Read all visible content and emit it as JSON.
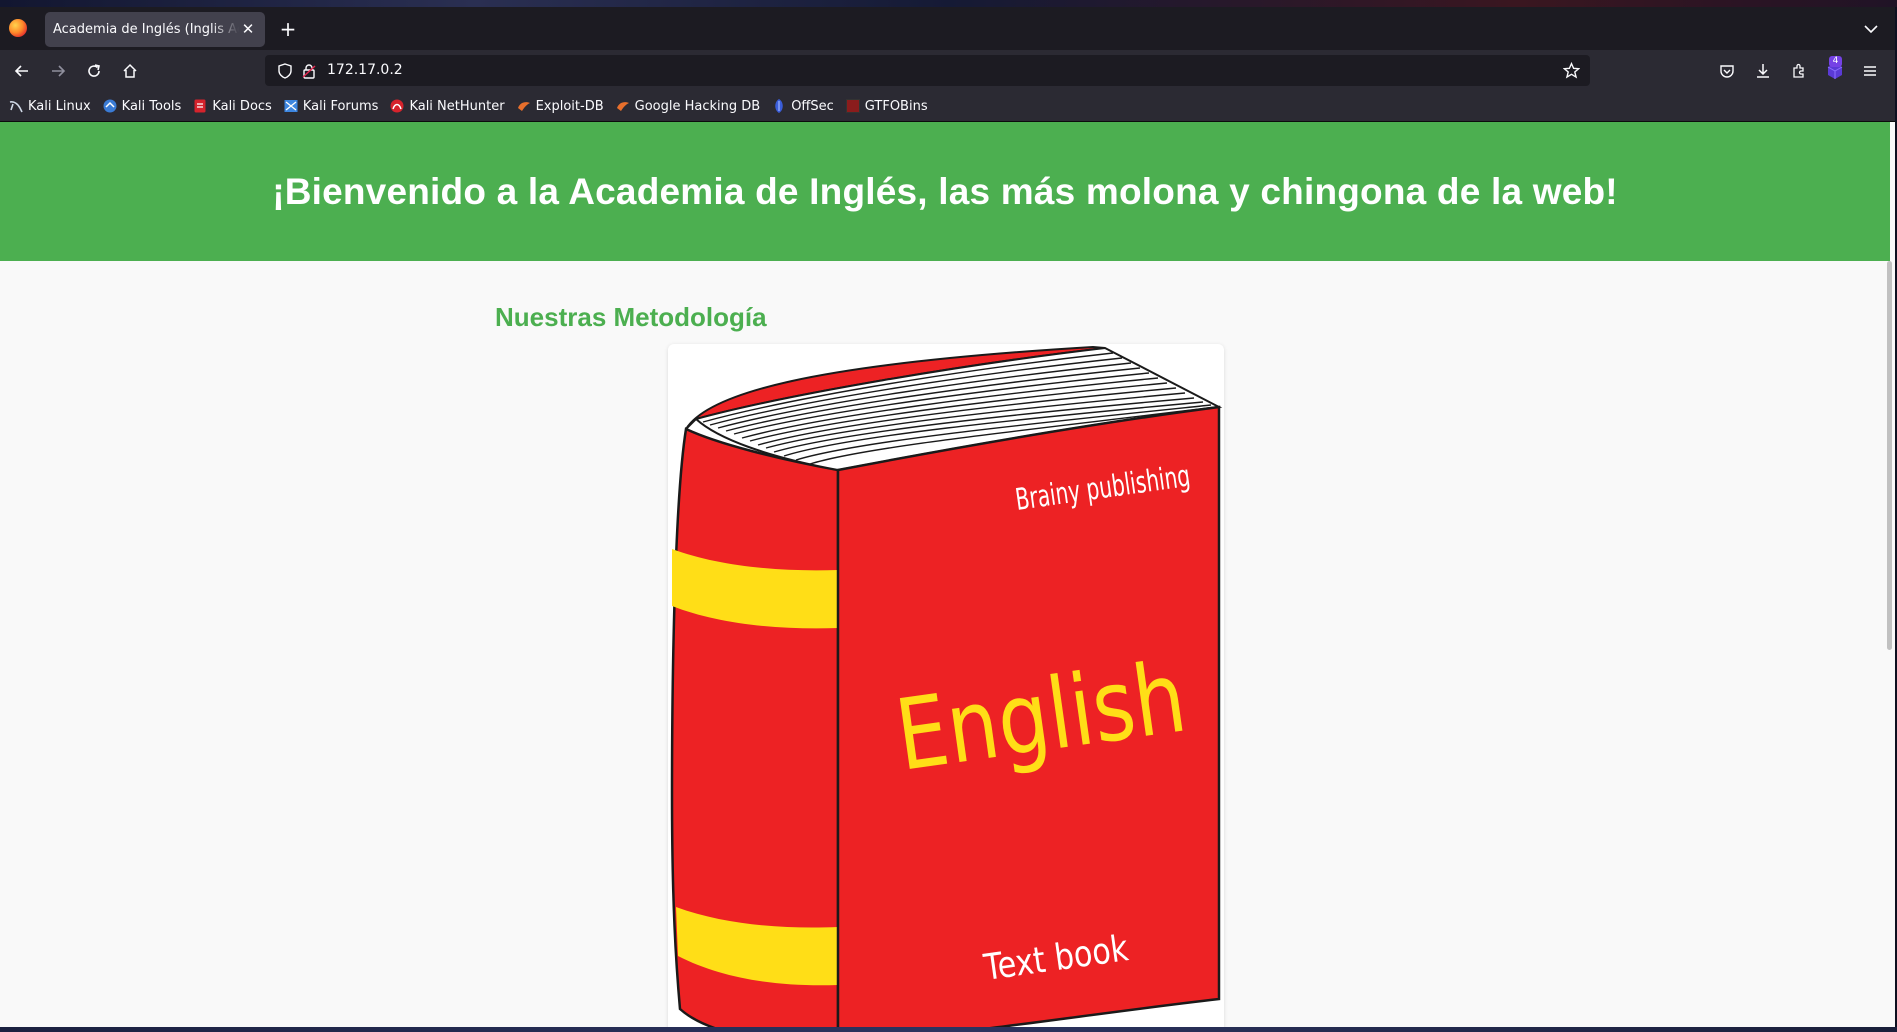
{
  "browser": {
    "tab_title": "Academia de Inglés (Inglis Academy)",
    "url": "172.17.0.2",
    "extensions_badge": "4"
  },
  "bookmarks": [
    {
      "label": "Kali Linux",
      "icon": "kali-linux-icon",
      "color": "#cfd8e6"
    },
    {
      "label": "Kali Tools",
      "icon": "kali-tools-icon",
      "color": "#3a7bd5"
    },
    {
      "label": "Kali Docs",
      "icon": "kali-docs-icon",
      "color": "#d6232c"
    },
    {
      "label": "Kali Forums",
      "icon": "kali-forums-icon",
      "color": "#3d86e0"
    },
    {
      "label": "Kali NetHunter",
      "icon": "kali-nethunter-icon",
      "color": "#d6232c"
    },
    {
      "label": "Exploit-DB",
      "icon": "exploit-db-icon",
      "color": "#e86f2c"
    },
    {
      "label": "Google Hacking DB",
      "icon": "google-hacking-db-icon",
      "color": "#e86f2c"
    },
    {
      "label": "OffSec",
      "icon": "offsec-icon",
      "color": "#3a5dd9"
    },
    {
      "label": "GTFOBins",
      "icon": "gtfobins-icon",
      "color": "#8a1c1c"
    }
  ],
  "page": {
    "header_text": "¡Bienvenido a la Academia de Inglés, las más molona y chingona de la web!",
    "section_title": "Nuestras Metodología",
    "book": {
      "publisher": "Brainy publishing",
      "title": "English",
      "subtitle": "Text book"
    }
  },
  "colors": {
    "header_green": "#4caf50",
    "book_red": "#ed2224",
    "book_yellow": "#ffde17"
  }
}
